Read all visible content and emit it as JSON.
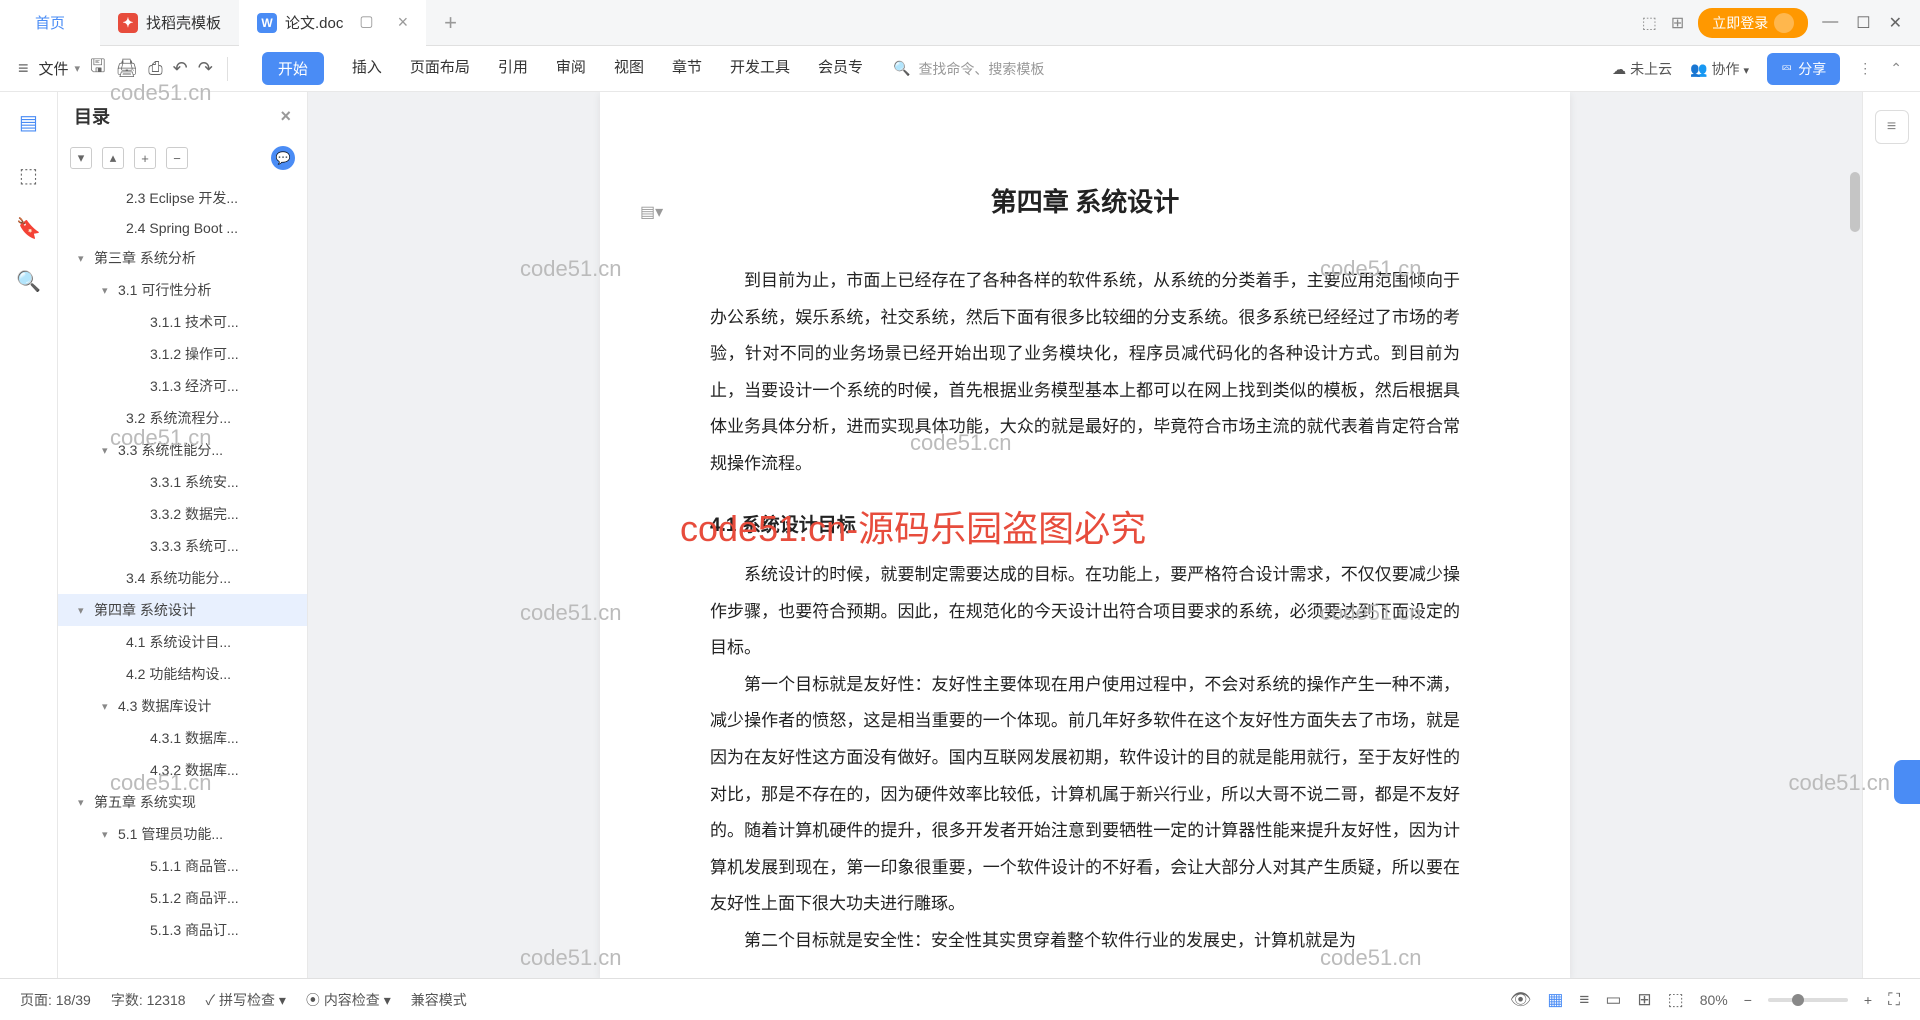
{
  "tabs": {
    "home": "首页",
    "template": "找稻壳模板",
    "doc": "论文.doc"
  },
  "login": "立即登录",
  "file": "文件",
  "menu": {
    "start": "开始",
    "insert": "插入",
    "layout": "页面布局",
    "ref": "引用",
    "review": "审阅",
    "view": "视图",
    "chapter": "章节",
    "devtools": "开发工具",
    "member": "会员专"
  },
  "search_placeholder": "查找命令、搜索模板",
  "cloud": "未上云",
  "collab": "协作",
  "share": "分享",
  "outline_title": "目录",
  "outline": [
    {
      "t": "2.3 Eclipse 开发...",
      "i": 3
    },
    {
      "t": "2.4 Spring Boot ...",
      "i": 3
    },
    {
      "t": "第三章  系统分析",
      "i": 1,
      "c": 1
    },
    {
      "t": "3.1 可行性分析",
      "i": 2,
      "c": 1
    },
    {
      "t": "3.1.1 技术可...",
      "i": 4
    },
    {
      "t": "3.1.2 操作可...",
      "i": 4
    },
    {
      "t": "3.1.3 经济可...",
      "i": 4
    },
    {
      "t": "3.2 系统流程分...",
      "i": 3
    },
    {
      "t": "3.3 系统性能分...",
      "i": 2,
      "c": 1
    },
    {
      "t": "3.3.1 系统安...",
      "i": 4
    },
    {
      "t": "3.3.2 数据完...",
      "i": 4
    },
    {
      "t": "3.3.3 系统可...",
      "i": 4
    },
    {
      "t": "3.4 系统功能分...",
      "i": 3
    },
    {
      "t": "第四章  系统设计",
      "i": 1,
      "c": 1,
      "sel": 1
    },
    {
      "t": "4.1 系统设计目...",
      "i": 3
    },
    {
      "t": "4.2 功能结构设...",
      "i": 3
    },
    {
      "t": "4.3 数据库设计",
      "i": 2,
      "c": 1
    },
    {
      "t": "4.3.1 数据库...",
      "i": 4
    },
    {
      "t": "4.3.2 数据库...",
      "i": 4
    },
    {
      "t": "第五章  系统实现",
      "i": 1,
      "c": 1
    },
    {
      "t": "5.1 管理员功能...",
      "i": 2,
      "c": 1
    },
    {
      "t": "5.1.1 商品管...",
      "i": 4
    },
    {
      "t": "5.1.2 商品评...",
      "i": 4
    },
    {
      "t": "5.1.3 商品订...",
      "i": 4
    }
  ],
  "doc": {
    "chapter": "第四章  系统设计",
    "p1": "到目前为止，市面上已经存在了各种各样的软件系统，从系统的分类着手，主要应用范围倾向于办公系统，娱乐系统，社交系统，然后下面有很多比较细的分支系统。很多系统已经经过了市场的考验，针对不同的业务场景已经开始出现了业务模块化，程序员减代码化的各种设计方式。到目前为止，当要设计一个系统的时候，首先根据业务模型基本上都可以在网上找到类似的模板，然后根据具体业务具体分析，进而实现具体功能，大众的就是最好的，毕竟符合市场主流的就代表着肯定符合常规操作流程。",
    "s41": "4.1  系统设计目标",
    "p2": "系统设计的时候，就要制定需要达成的目标。在功能上，要严格符合设计需求，不仅仅要减少操作步骤，也要符合预期。因此，在规范化的今天设计出符合项目要求的系统，必须要达到下面设定的目标。",
    "p3": "第一个目标就是友好性：友好性主要体现在用户使用过程中，不会对系统的操作产生一种不满，减少操作者的愤怒，这是相当重要的一个体现。前几年好多软件在这个友好性方面失去了市场，就是因为在友好性这方面没有做好。国内互联网发展初期，软件设计的目的就是能用就行，至于友好性的对比，那是不存在的，因为硬件效率比较低，计算机属于新兴行业，所以大哥不说二哥，都是不友好的。随着计算机硬件的提升，很多开发者开始注意到要牺牲一定的计算器性能来提升友好性，因为计算机发展到现在，第一印象很重要，一个软件设计的不好看，会让大部分人对其产生质疑，所以要在友好性上面下很大功夫进行雕琢。",
    "p4": "第二个目标就是安全性：安全性其实贯穿着整个软件行业的发展史，计算机就是为"
  },
  "status": {
    "page": "页面: 18/39",
    "words": "字数: 12318",
    "spell": "拼写检查",
    "content": "内容检查",
    "compat": "兼容模式",
    "zoom": "80%"
  },
  "watermarks": {
    "text": "code51.cn",
    "red": "code51.cn-源码乐园盗图必究"
  }
}
